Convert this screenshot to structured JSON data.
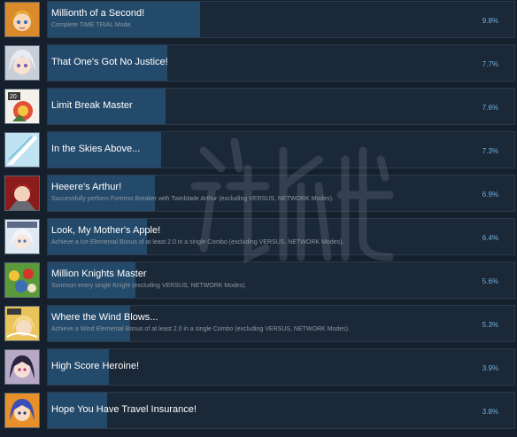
{
  "achievements": [
    {
      "title": "Millionth of a Second!",
      "description": "Complete TIME TRIAL Mode.",
      "percent_label": "9.8%",
      "percent": 9.8,
      "icon": "anime-heroine-blonde-icon"
    },
    {
      "title": "That One's Got No Justice!",
      "description": "",
      "percent_label": "7.7%",
      "percent": 7.7,
      "icon": "anime-heroine-silver-hair-icon"
    },
    {
      "title": "Limit Break Master",
      "description": "",
      "percent_label": "7.6%",
      "percent": 7.6,
      "icon": "combo-badge-icon"
    },
    {
      "title": "In the Skies Above...",
      "description": "",
      "percent_label": "7.3%",
      "percent": 7.3,
      "icon": "sky-slash-icon"
    },
    {
      "title": "Heeere's Arthur!",
      "description": "Successfully perform Fortress Breaker with Twinblade Arthur (excluding VERSUS, NETWORK Modes).",
      "percent_label": "6.9%",
      "percent": 6.9,
      "icon": "arthur-red-knight-icon"
    },
    {
      "title": "Look, My Mother's Apple!",
      "description": "Achieve a Ice Elemental Bonus of at least 2.0 in a single Combo (excluding VERSUS, NETWORK Modes).",
      "percent_label": "6.4%",
      "percent": 6.4,
      "icon": "ice-heroine-icon"
    },
    {
      "title": "Million Knights Master",
      "description": "Summon every single Knight (excluding VERSUS, NETWORK Modes).",
      "percent_label": "5.6%",
      "percent": 5.6,
      "icon": "knights-group-icon"
    },
    {
      "title": "Where the Wind Blows...",
      "description": "Achieve a Wind Elemental Bonus of at least 2.0 in a single Combo (excluding VERSUS, NETWORK Modes).",
      "percent_label": "5.3%",
      "percent": 5.3,
      "icon": "wind-heroine-icon"
    },
    {
      "title": "High Score Heroine!",
      "description": "",
      "percent_label": "3.9%",
      "percent": 3.9,
      "icon": "dark-hair-heroine-icon"
    },
    {
      "title": "Hope You Have Travel Insurance!",
      "description": "",
      "percent_label": "3.8%",
      "percent": 3.8,
      "icon": "blue-hair-heroine-icon"
    }
  ],
  "bar_scale_max_percent": 30,
  "colors": {
    "bar": "#244a6b",
    "percent_text": "#6fb1e0",
    "panel": "#1b2838",
    "background": "#16202d"
  }
}
